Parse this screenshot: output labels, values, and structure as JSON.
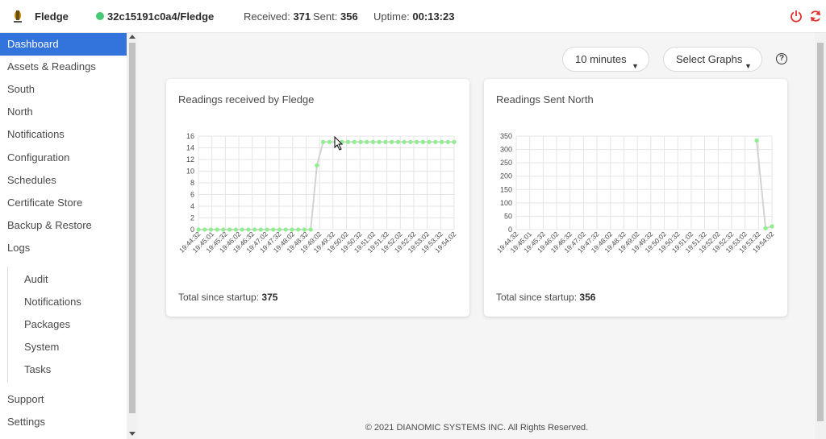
{
  "navbar": {
    "brand": "Fledge",
    "service_name": "32c15191c0a4/Fledge",
    "received_label": "Received:",
    "received_value": "371",
    "sent_label": "Sent:",
    "sent_value": "356",
    "uptime_label": "Uptime:",
    "uptime_value": "00:13:23",
    "status_color": "#48c774",
    "icons": [
      "power-icon",
      "refresh-icon"
    ]
  },
  "sidebar": {
    "items": [
      {
        "label": "Dashboard",
        "active": true
      },
      {
        "label": "Assets & Readings"
      },
      {
        "label": "South"
      },
      {
        "label": "North"
      },
      {
        "label": "Notifications"
      },
      {
        "label": "Configuration"
      },
      {
        "label": "Schedules"
      },
      {
        "label": "Certificate Store"
      },
      {
        "label": "Backup & Restore"
      },
      {
        "label": "Logs"
      }
    ],
    "log_items": [
      "Audit",
      "Notifications",
      "Packages",
      "System",
      "Tasks"
    ],
    "bottom_items": [
      "Support",
      "Settings"
    ]
  },
  "controls": {
    "time_range": "10 minutes",
    "select_graphs": "Select Graphs",
    "help": "?"
  },
  "cards": [
    {
      "title": "Readings received by Fledge",
      "total_label": "Total since startup:",
      "total_value": "375"
    },
    {
      "title": "Readings Sent North",
      "total_label": "Total since startup:",
      "total_value": "356"
    }
  ],
  "chart_data": [
    {
      "type": "line",
      "title": "Readings received by Fledge",
      "xlabels": [
        "19:44:32",
        "19:45:01",
        "19:45:32",
        "19:46:02",
        "19:46:32",
        "19:47:02",
        "19:47:32",
        "19:48:02",
        "19:48:32",
        "19:49:02",
        "19:49:32",
        "19:50:02",
        "19:50:32",
        "19:51:02",
        "19:51:32",
        "19:52:02",
        "19:52:32",
        "19:53:02",
        "19:53:32",
        "19:54:02"
      ],
      "ylim": [
        0,
        16
      ],
      "yticks": [
        0,
        2,
        4,
        6,
        8,
        10,
        12,
        14,
        16
      ],
      "values": [
        0,
        0,
        0,
        0,
        0,
        0,
        0,
        0,
        0,
        0,
        0,
        0,
        0,
        0,
        0,
        0,
        0,
        0,
        0,
        11,
        15,
        15,
        15,
        15,
        15,
        15,
        15,
        15,
        15,
        15,
        15,
        15,
        15,
        15,
        15,
        15,
        15,
        15,
        15,
        15,
        15,
        15
      ],
      "color": "#90ee90"
    },
    {
      "type": "line",
      "title": "Readings Sent North",
      "xlabels": [
        "19:44:32",
        "19:45:01",
        "19:45:32",
        "19:46:02",
        "19:46:32",
        "19:47:02",
        "19:47:32",
        "19:48:02",
        "19:48:32",
        "19:49:02",
        "19:49:32",
        "19:50:02",
        "19:50:32",
        "19:51:02",
        "19:51:32",
        "19:52:02",
        "19:52:32",
        "19:53:02",
        "19:53:32",
        "19:54:02"
      ],
      "ylim": [
        0,
        350
      ],
      "yticks": [
        0,
        50,
        100,
        150,
        200,
        250,
        300,
        350
      ],
      "points": [
        [
          0.94,
          334
        ],
        [
          0.975,
          5
        ],
        [
          1.0,
          12
        ]
      ],
      "color": "#90ee90"
    }
  ],
  "footer": "© 2021 DIANOMIC SYSTEMS INC. All Rights Reserved."
}
